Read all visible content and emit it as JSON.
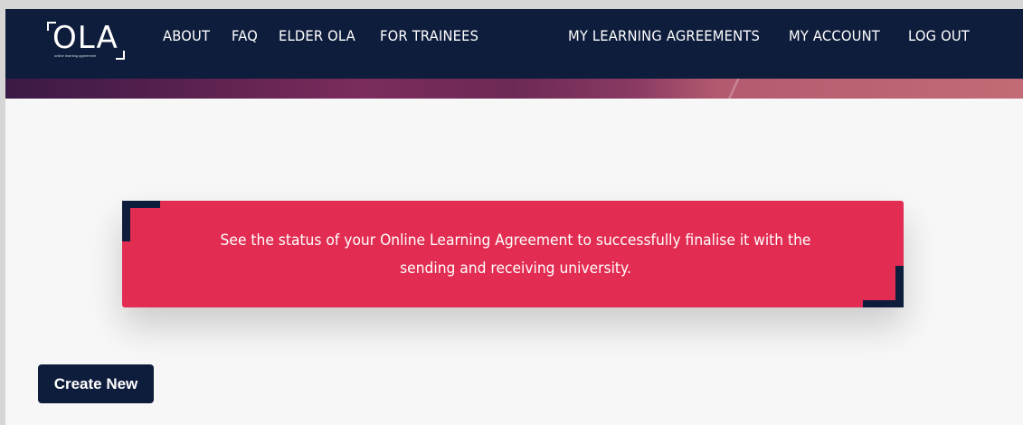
{
  "logo": {
    "text": "OLA",
    "subtitle": "online learning agreement"
  },
  "nav": {
    "left": [
      {
        "label": "ABOUT"
      },
      {
        "label": "FAQ"
      },
      {
        "label": "ELDER OLA"
      },
      {
        "label": "FOR TRAINEES"
      }
    ],
    "right": [
      {
        "label": "MY LEARNING AGREEMENTS"
      },
      {
        "label": "MY ACCOUNT"
      },
      {
        "label": "LOG OUT"
      }
    ]
  },
  "banner": {
    "line1": "See the status of your Online Learning Agreement to successfully finalise it with the",
    "line2": "sending and receiving university."
  },
  "actions": {
    "create_new_label": "Create New"
  },
  "colors": {
    "navy": "#0f1d3d",
    "accent_red": "#e22c51",
    "page_background": "#f7f7f7"
  }
}
